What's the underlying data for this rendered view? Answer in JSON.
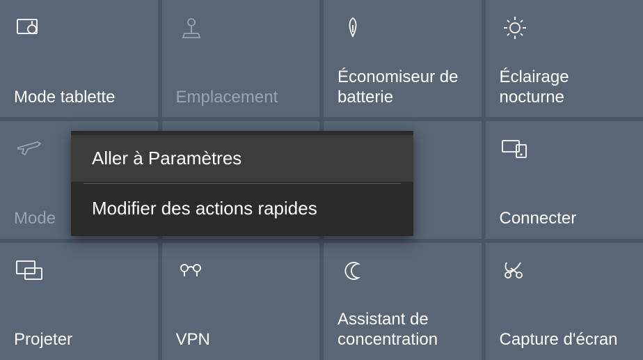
{
  "tiles": {
    "tablet_mode": {
      "label": "Mode tablette"
    },
    "location": {
      "label": "Emplacement"
    },
    "battery_saver": {
      "label": "Économiseur de batterie"
    },
    "night_light": {
      "label": "Éclairage nocturne"
    },
    "airplane_mode": {
      "label": "Mode"
    },
    "connect": {
      "label": "Connecter"
    },
    "project": {
      "label": "Projeter"
    },
    "vpn": {
      "label": "VPN"
    },
    "focus_assist": {
      "label": "Assistant de concentration"
    },
    "screen_snip": {
      "label": "Capture d'écran"
    }
  },
  "context_menu": {
    "go_to_settings": "Aller à Paramètres",
    "edit_quick_actions": "Modifier des actions rapides"
  }
}
